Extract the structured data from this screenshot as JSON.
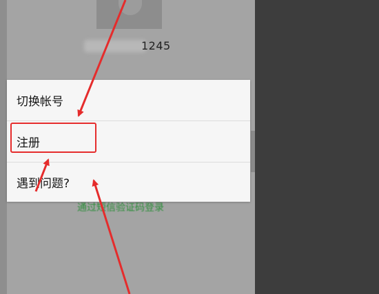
{
  "account": {
    "number_suffix": "1245"
  },
  "menu": {
    "items": [
      {
        "label": "切换帐号"
      },
      {
        "label": "注册"
      },
      {
        "label": "遇到问题?"
      }
    ]
  },
  "background": {
    "sms_login_link": "通过短信验证码登录"
  },
  "colors": {
    "annotation_red": "#e52c2c",
    "link_green": "#2f8f3c",
    "overlay_gray": "#a4a4a4",
    "menu_background": "#f6f6f6",
    "page_background": "#3d3d3d"
  }
}
